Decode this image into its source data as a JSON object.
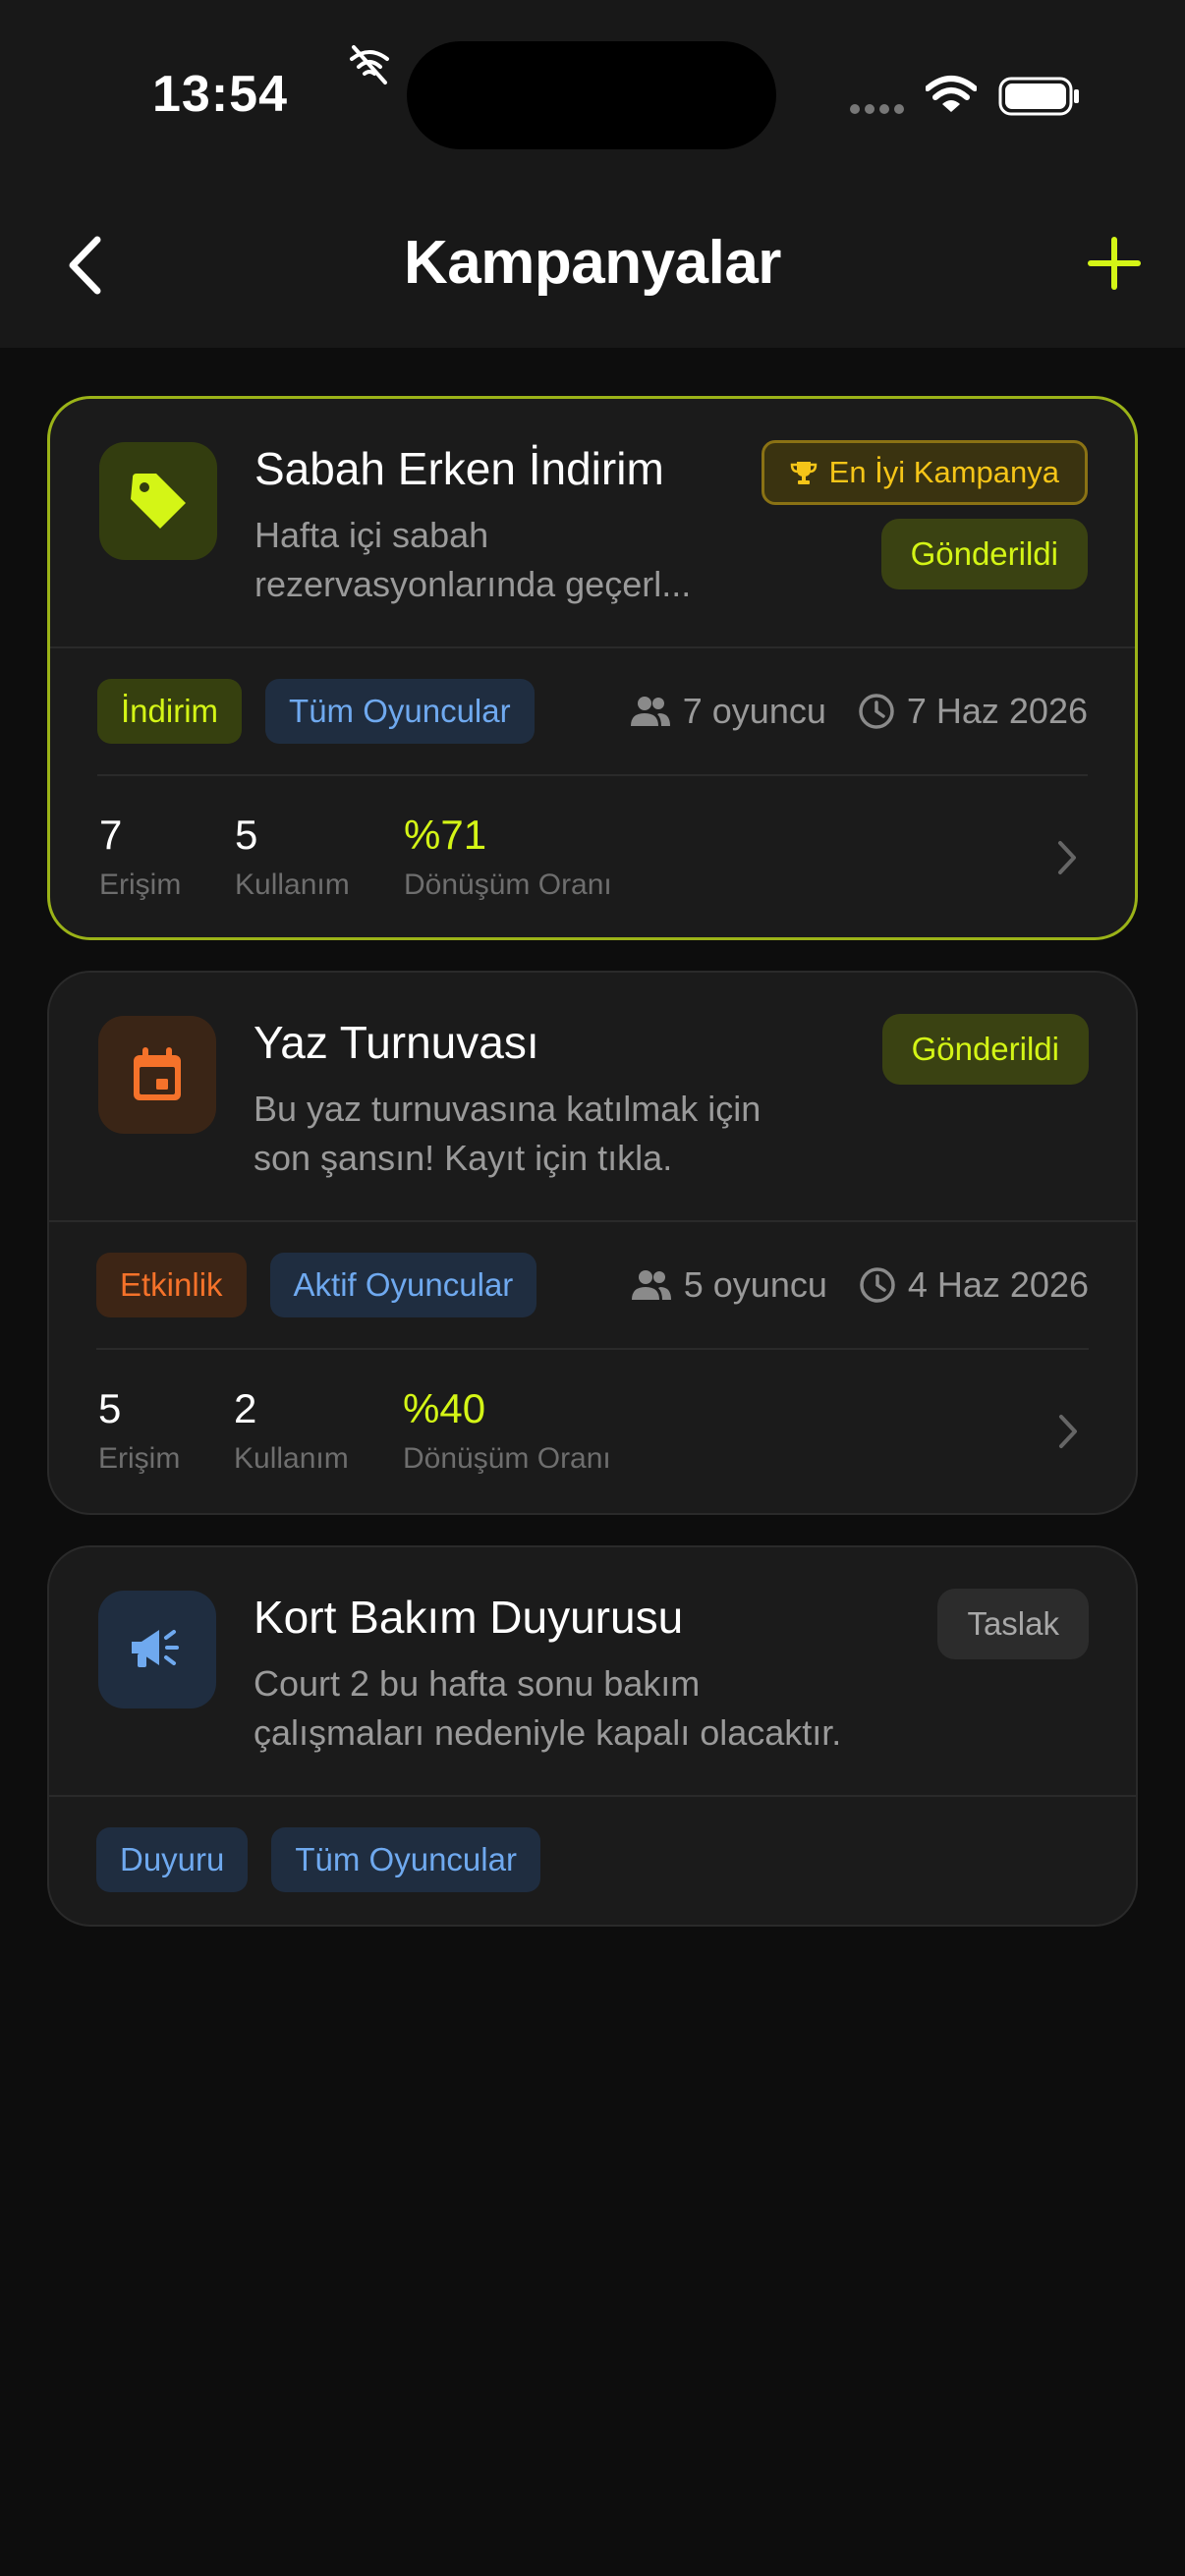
{
  "status_bar": {
    "time": "13:54"
  },
  "header": {
    "title": "Kampanyalar"
  },
  "campaigns": [
    {
      "title": "Sabah Erken İndirim",
      "desc_line1": "Hafta içi sabah",
      "desc_line2": "rezervasyonlarında geçerl...",
      "best_badge": "En İyi Kampanya",
      "status": "Gönderildi",
      "type_tag": "İndirim",
      "audience_tag": "Tüm Oyuncular",
      "players": "7 oyuncu",
      "date": "7 Haz 2026",
      "stats": {
        "reach": "7",
        "reach_label": "Erişim",
        "usage": "5",
        "usage_label": "Kullanım",
        "conversion": "%71",
        "conversion_label": "Dönüşüm Oranı"
      }
    },
    {
      "title": "Yaz Turnuvası",
      "desc_line1": "Bu yaz turnuvasına katılmak için",
      "desc_line2": "son şansın! Kayıt için tıkla.",
      "status": "Gönderildi",
      "type_tag": "Etkinlik",
      "audience_tag": "Aktif Oyuncular",
      "players": "5 oyuncu",
      "date": "4 Haz 2026",
      "stats": {
        "reach": "5",
        "reach_label": "Erişim",
        "usage": "2",
        "usage_label": "Kullanım",
        "conversion": "%40",
        "conversion_label": "Dönüşüm Oranı"
      }
    },
    {
      "title": "Kort Bakım Duyurusu",
      "desc_line1": "Court 2 bu hafta sonu bakım",
      "desc_line2": "çalışmaları nedeniyle kapalı olacaktır.",
      "status": "Taslak",
      "type_tag": "Duyuru",
      "audience_tag": "Tüm Oyuncular"
    }
  ],
  "colors": {
    "accent": "#d4f516",
    "background": "#0d0d0d",
    "card": "#1b1b1b",
    "best_border": "#9bb318",
    "gold": "#f5c518",
    "blue": "#6fa9ef",
    "orange": "#f5722a"
  },
  "icons": {
    "back": "chevron-left-icon",
    "add": "plus-icon",
    "campaign_1": "tag-icon",
    "campaign_2": "calendar-icon",
    "campaign_3": "megaphone-icon",
    "trophy": "trophy-icon",
    "players": "people-icon",
    "date": "clock-icon",
    "open": "chevron-right-icon"
  }
}
